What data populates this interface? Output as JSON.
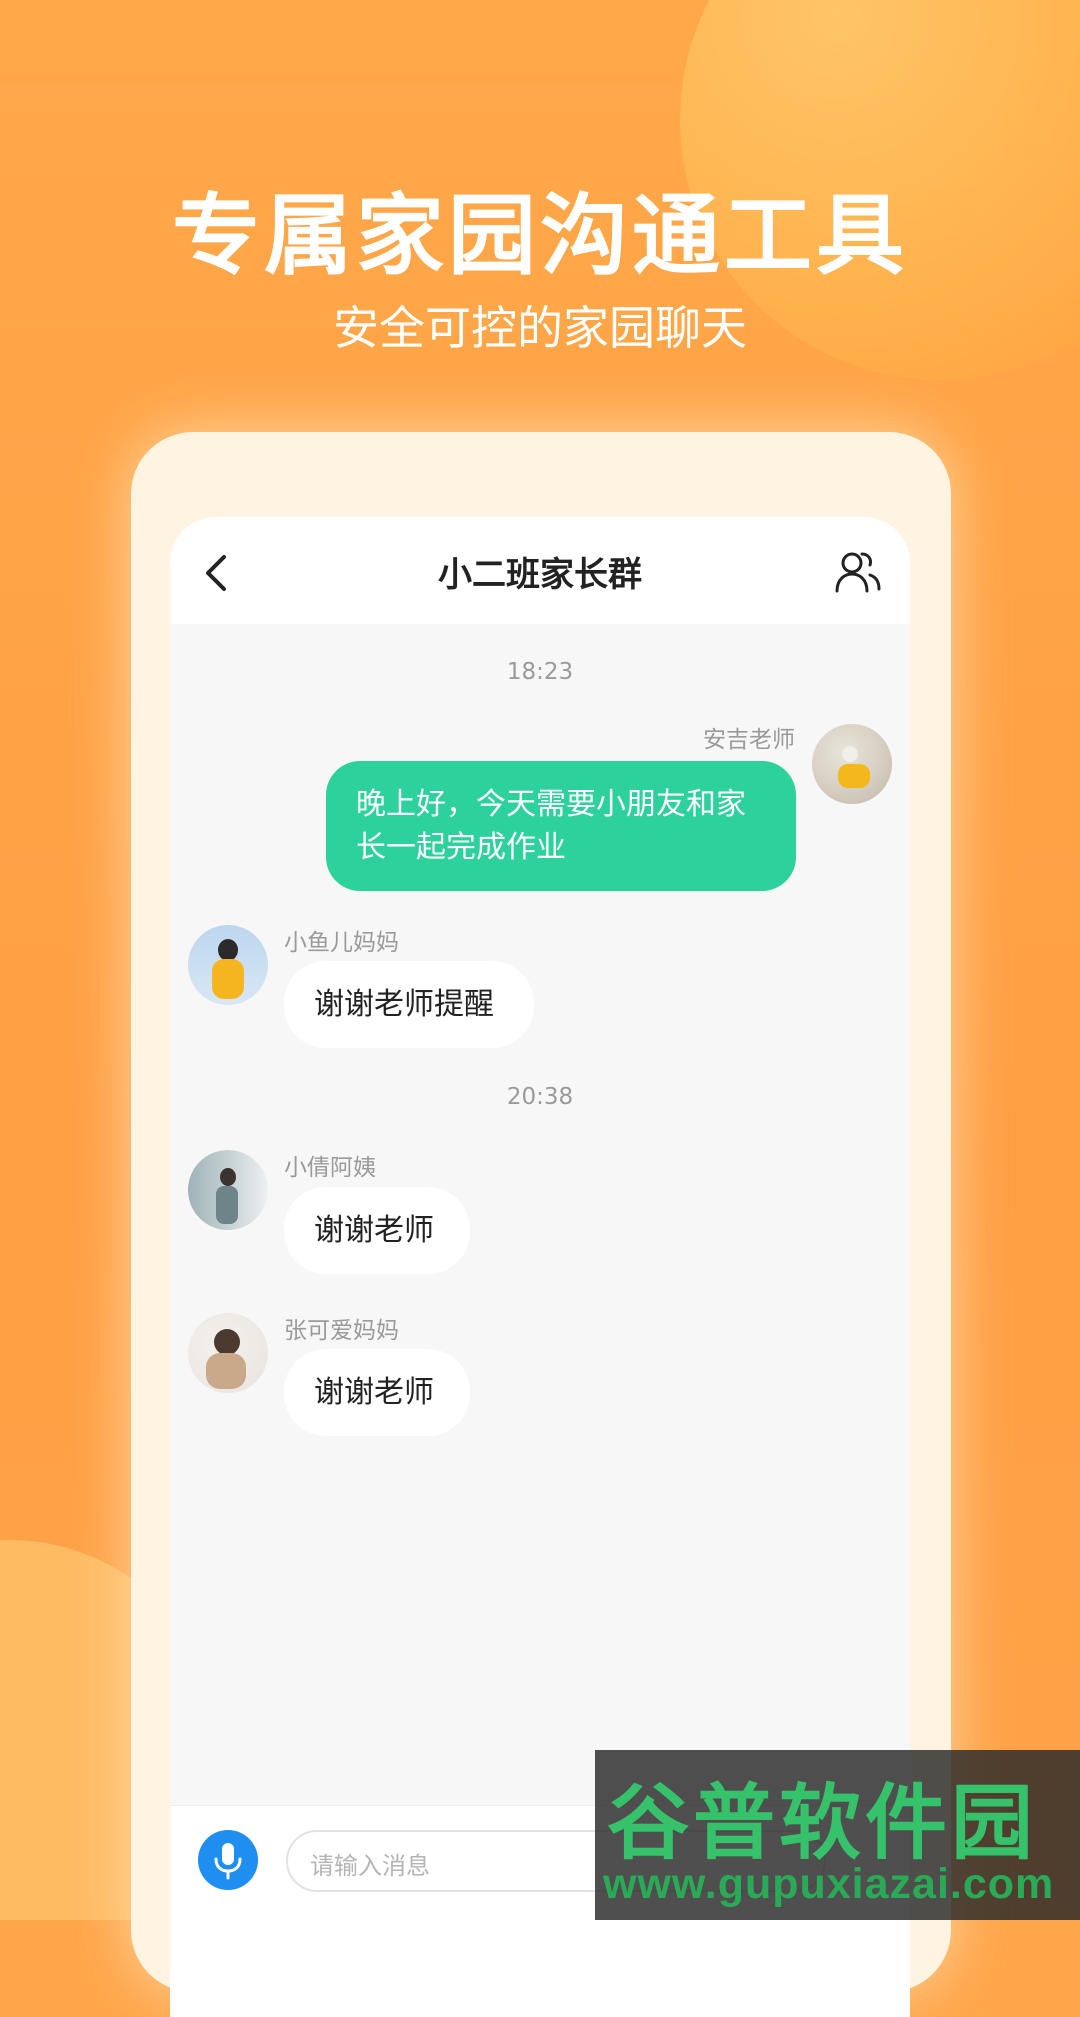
{
  "promo": {
    "headline": "专属家园沟通工具",
    "subline": "安全可控的家园聊天"
  },
  "chat": {
    "title": "小二班家长群",
    "messages": [
      {
        "type": "time",
        "text": "18:23"
      },
      {
        "type": "msg",
        "side": "right",
        "sender": "安吉老师",
        "text": "晚上好，今天需要小朋友和家长一起完成作业"
      },
      {
        "type": "msg",
        "side": "left",
        "sender": "小鱼儿妈妈",
        "text": "谢谢老师提醒"
      },
      {
        "type": "time",
        "text": "20:38"
      },
      {
        "type": "msg",
        "side": "left",
        "sender": "小倩阿姨",
        "text": "谢谢老师"
      },
      {
        "type": "msg",
        "side": "left",
        "sender": "张可爱妈妈",
        "text": "谢谢老师"
      }
    ],
    "input_placeholder": "请输入消息"
  },
  "icons": {
    "back": "chevron-left-icon",
    "group": "group-members-icon",
    "mic": "microphone-icon"
  },
  "colors": {
    "background": "#ffa64a",
    "my_bubble": "#2dd19b",
    "mic_button": "#1e8ff0"
  },
  "watermark": {
    "line1": "谷普软件园",
    "line2": "www.gupuxiazai.com"
  }
}
